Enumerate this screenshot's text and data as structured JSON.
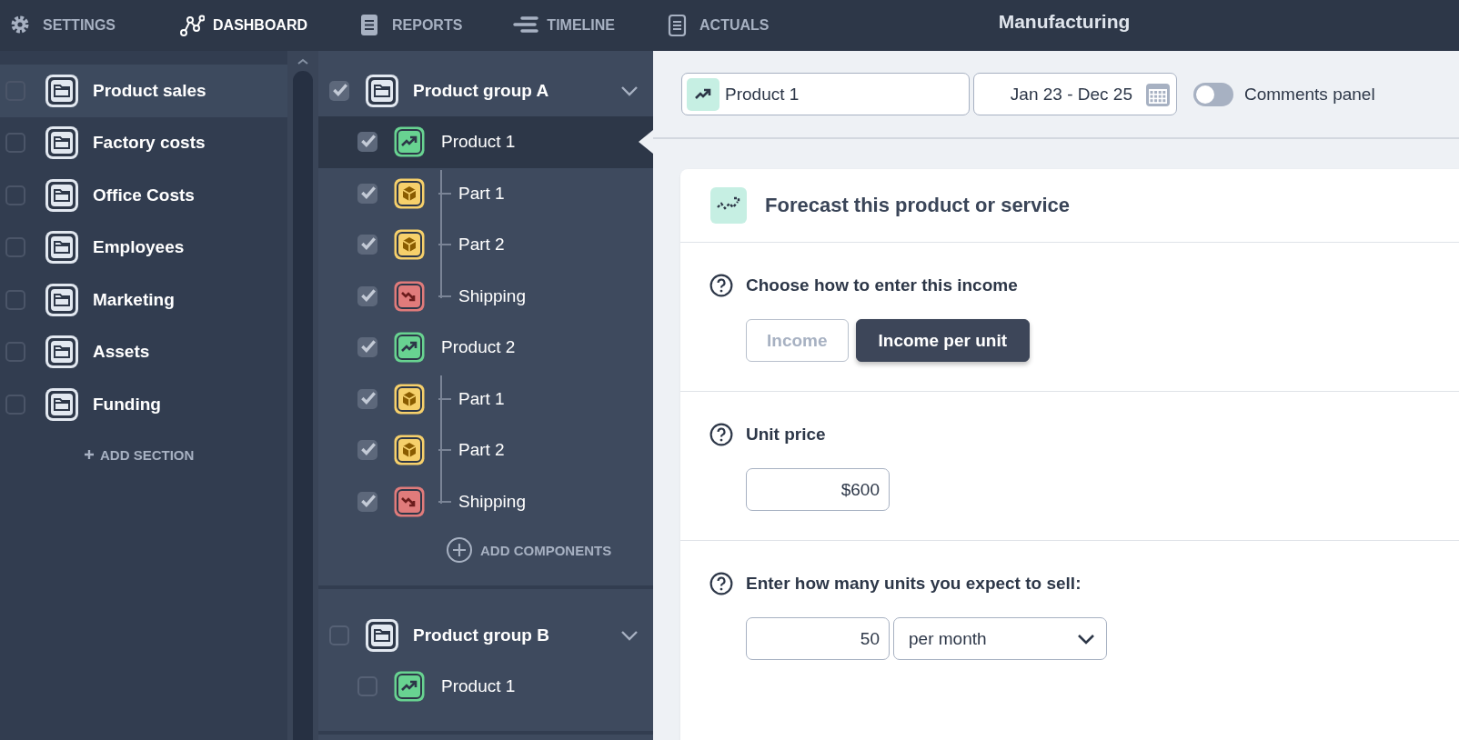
{
  "nav": {
    "items": [
      {
        "kind": "settings",
        "label": "SETTINGS",
        "selected": false
      },
      {
        "kind": "dashboard",
        "label": "DASHBOARD",
        "selected": true
      },
      {
        "kind": "reports",
        "label": "REPORTS",
        "selected": false
      },
      {
        "kind": "timeline",
        "label": "TIMELINE",
        "selected": false
      },
      {
        "kind": "actuals",
        "label": "ACTUALS",
        "selected": false
      }
    ],
    "title": "Manufacturing"
  },
  "sidebar": {
    "items": [
      {
        "label": "Product sales",
        "checked": false,
        "selected": true
      },
      {
        "label": "Factory costs",
        "checked": false,
        "selected": false
      },
      {
        "label": "Office Costs",
        "checked": false,
        "selected": false
      },
      {
        "label": "Employees",
        "checked": false,
        "selected": false
      },
      {
        "label": "Marketing",
        "checked": false,
        "selected": false
      },
      {
        "label": "Assets",
        "checked": false,
        "selected": false
      },
      {
        "label": "Funding",
        "checked": false,
        "selected": false
      }
    ],
    "add_section": "ADD SECTION"
  },
  "groups": [
    {
      "title": "Product group A",
      "checked": true,
      "expanded": true,
      "add_components": "ADD COMPONENTS",
      "items": [
        {
          "kind": "income",
          "label": "Product 1",
          "checked": true,
          "selected": true,
          "children": [
            {
              "kind": "part",
              "label": "Part 1",
              "checked": true
            },
            {
              "kind": "part",
              "label": "Part 2",
              "checked": true
            },
            {
              "kind": "cost",
              "label": "Shipping",
              "checked": true
            }
          ]
        },
        {
          "kind": "income",
          "label": "Product 2",
          "checked": true,
          "selected": false,
          "children": [
            {
              "kind": "part",
              "label": "Part 1",
              "checked": true
            },
            {
              "kind": "part",
              "label": "Part 2",
              "checked": true
            },
            {
              "kind": "cost",
              "label": "Shipping",
              "checked": true
            }
          ]
        }
      ]
    },
    {
      "title": "Product group B",
      "checked": false,
      "expanded": true,
      "items": [
        {
          "kind": "income",
          "label": "Product 1",
          "checked": false,
          "selected": false
        }
      ]
    }
  ],
  "toolbar": {
    "product": "Product 1",
    "date_range": "Jan 23 - Dec 25",
    "comments": {
      "label": "Comments panel",
      "on": false
    }
  },
  "card": {
    "title": "Forecast this product or service",
    "sections": [
      {
        "kind": "choice",
        "question": "Choose how to enter this income",
        "options": [
          {
            "label": "Income",
            "selected": false
          },
          {
            "label": "Income per unit",
            "selected": true
          }
        ]
      },
      {
        "kind": "amount",
        "question": "Unit price",
        "value": "$600"
      },
      {
        "kind": "units",
        "question": "Enter how many units you expect to sell:",
        "value": "50",
        "period": "per month"
      }
    ]
  }
}
